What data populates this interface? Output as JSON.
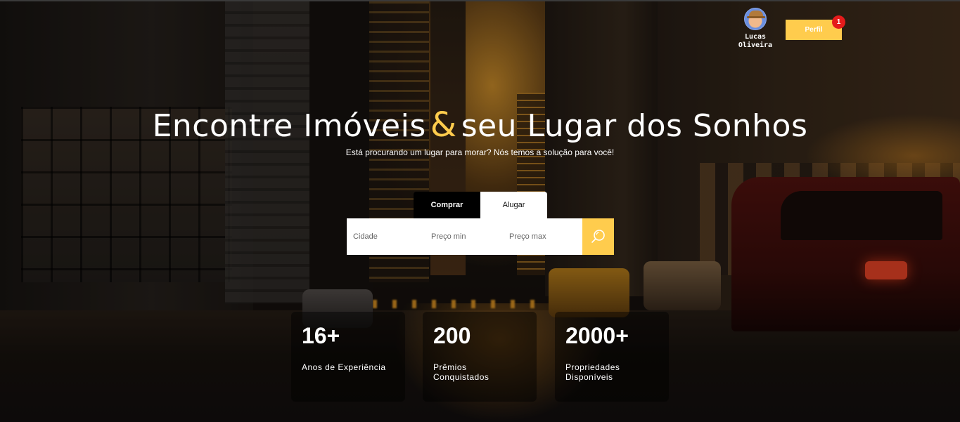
{
  "header": {
    "user_name": "Lucas Oliveira",
    "profile_button": "Perfil",
    "notification_count": "1"
  },
  "hero": {
    "title_part1": "Encontre Imóveis",
    "title_amp": "&",
    "title_part2": "seu Lugar dos Sonhos",
    "subtitle": "Está procurando um lugar para morar? Nós temos a solução para você!"
  },
  "search": {
    "tabs": [
      {
        "label": "Comprar",
        "active": true
      },
      {
        "label": "Alugar",
        "active": false
      }
    ],
    "city_placeholder": "Cidade",
    "price_min_placeholder": "Preço min",
    "price_max_placeholder": "Preço max",
    "button_icon": "search-icon"
  },
  "stats": [
    {
      "value": "16+",
      "label": "Anos de Experiência"
    },
    {
      "value": "200",
      "label": "Prêmios Conquistados"
    },
    {
      "value": "2000+",
      "label": "Propriedades Disponíveis"
    }
  ],
  "colors": {
    "accent": "#ffcc4d",
    "badge": "#e51b1b"
  }
}
